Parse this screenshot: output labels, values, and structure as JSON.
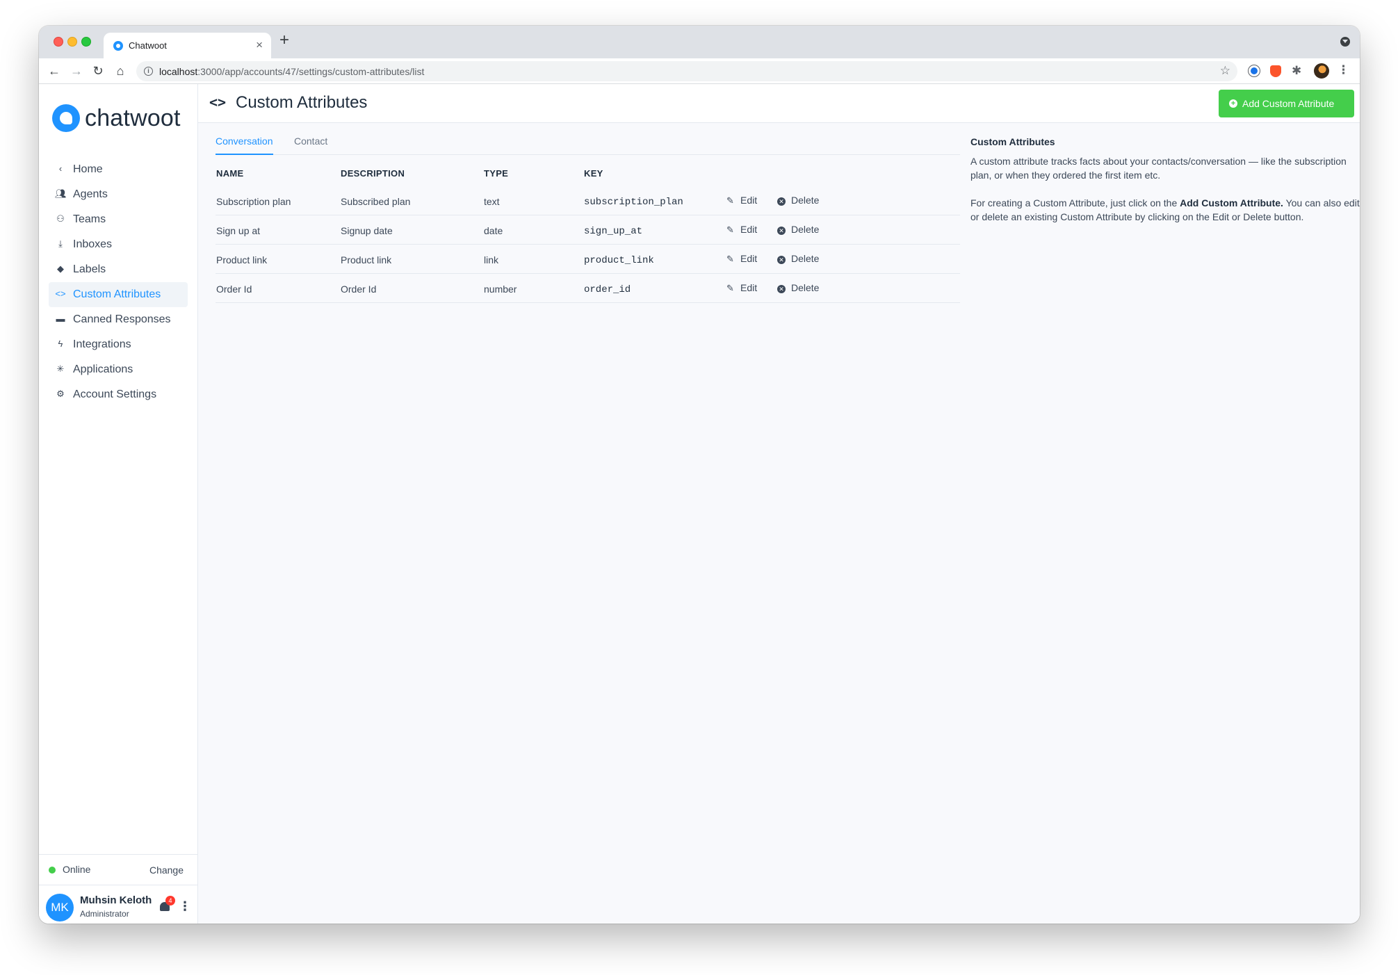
{
  "browser": {
    "tab_title": "Chatwoot",
    "url_host": "localhost",
    "url_path": ":3000/app/accounts/47/settings/custom-attributes/list"
  },
  "brand": {
    "name": "chatwoot",
    "accent": "#1f93ff",
    "success": "#44ce4b"
  },
  "sidebar": {
    "items": [
      {
        "label": "Home",
        "icon": "chevron-left-icon"
      },
      {
        "label": "Agents",
        "icon": "people-icon"
      },
      {
        "label": "Teams",
        "icon": "team-icon"
      },
      {
        "label": "Inboxes",
        "icon": "inbox-icon"
      },
      {
        "label": "Labels",
        "icon": "tag-icon"
      },
      {
        "label": "Custom Attributes",
        "icon": "code-icon",
        "active": true
      },
      {
        "label": "Canned Responses",
        "icon": "chat-icon"
      },
      {
        "label": "Integrations",
        "icon": "flash-icon"
      },
      {
        "label": "Applications",
        "icon": "asterisk-icon"
      },
      {
        "label": "Account Settings",
        "icon": "gear-icon"
      }
    ],
    "status": "Online",
    "change_label": "Change",
    "user": {
      "initials": "MK",
      "name": "Muhsin Keloth",
      "role": "Administrator",
      "notification_count": "4"
    }
  },
  "header": {
    "title": "Custom Attributes",
    "add_button": "Add Custom Attribute"
  },
  "tabs": [
    "Conversation",
    "Contact"
  ],
  "table": {
    "headers": [
      "NAME",
      "DESCRIPTION",
      "TYPE",
      "KEY"
    ],
    "edit_label": "Edit",
    "delete_label": "Delete",
    "rows": [
      {
        "name": "Subscription plan",
        "description": "Subscribed plan",
        "type": "text",
        "key": "subscription_plan"
      },
      {
        "name": "Sign up at",
        "description": "Signup date",
        "type": "date",
        "key": "sign_up_at"
      },
      {
        "name": "Product link",
        "description": "Product link",
        "type": "link",
        "key": "product_link"
      },
      {
        "name": "Order Id",
        "description": "Order Id",
        "type": "number",
        "key": "order_id"
      }
    ]
  },
  "help": {
    "title": "Custom Attributes",
    "p1": "A custom attribute tracks facts about your contacts/conversation — like the subscription plan, or when they ordered the first item etc.",
    "p2_start": "For creating a Custom Attribute, just click on the ",
    "p2_strong": "Add Custom Attribute.",
    "p2_end": " You can also edit or delete an existing Custom Attribute by clicking on the Edit or Delete button."
  }
}
